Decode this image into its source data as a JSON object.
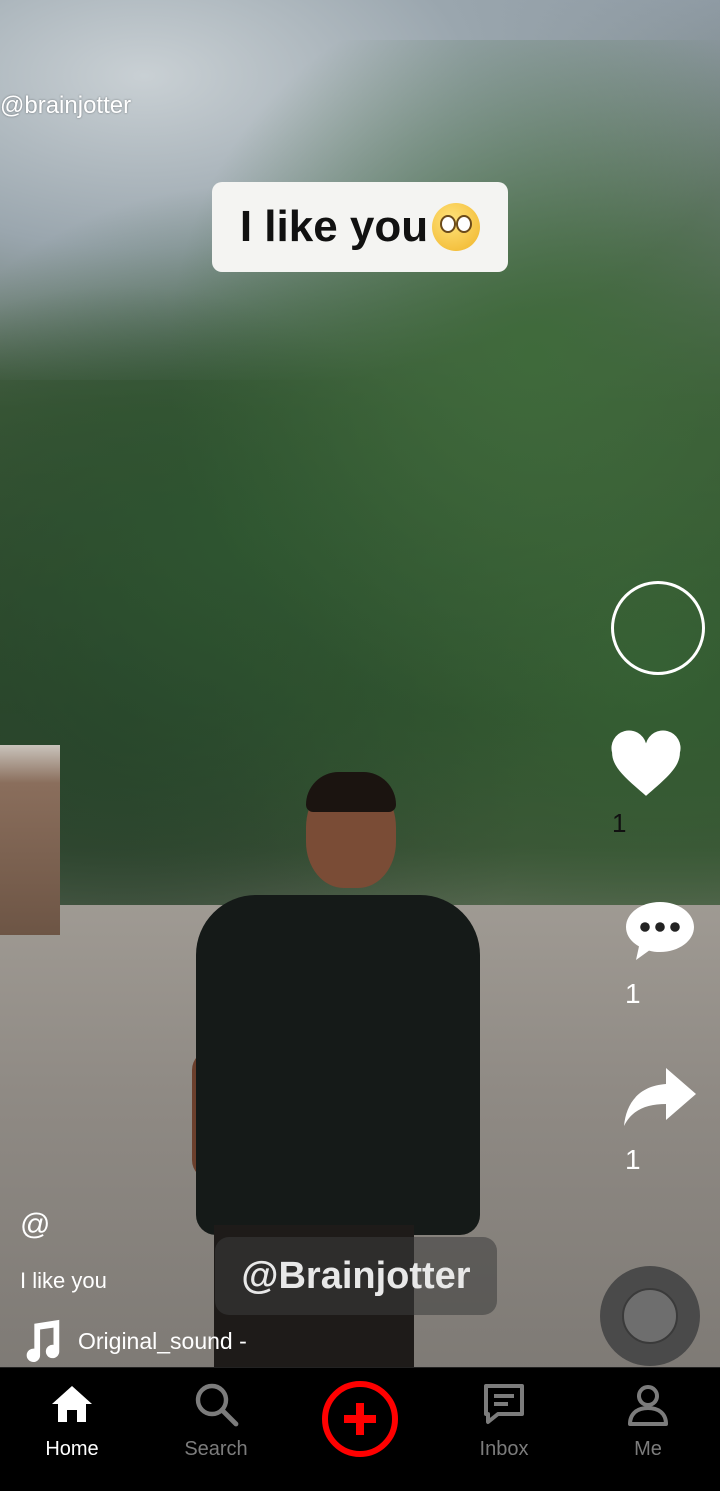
{
  "video": {
    "watermark_top": "@brainjotter",
    "caption_text": "I like you",
    "caption_emoji": "eye-roll-emoji",
    "watermark_bottom": "@Brainjotter"
  },
  "actions": {
    "like_count": "1",
    "comment_count": "1",
    "share_count": "1"
  },
  "post_info": {
    "username": "@",
    "description": "I like you",
    "music": "Original_sound -"
  },
  "tabbar": {
    "tabs": [
      {
        "label": "Home",
        "icon": "home-icon",
        "active": true
      },
      {
        "label": "Search",
        "icon": "search-icon",
        "active": false
      },
      {
        "label": "",
        "icon": "create-plus-icon",
        "active": false
      },
      {
        "label": "Inbox",
        "icon": "inbox-icon",
        "active": false
      },
      {
        "label": "Me",
        "icon": "profile-icon",
        "active": false
      }
    ]
  },
  "colors": {
    "accent": "#ff0000",
    "tab_inactive": "#7c7c7c",
    "tab_active": "#ffffff"
  }
}
